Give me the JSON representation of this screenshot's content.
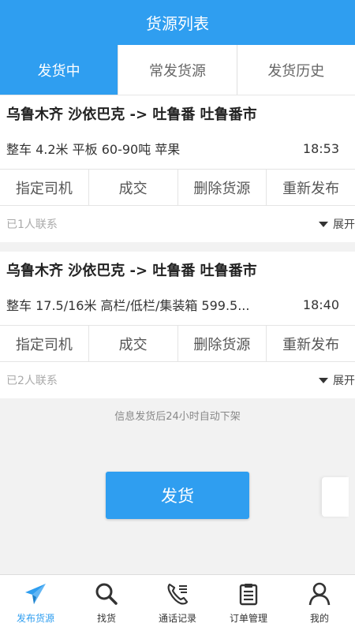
{
  "header": {
    "title": "货源列表"
  },
  "tabs": [
    {
      "label": "发货中",
      "active": true
    },
    {
      "label": "常发货源",
      "active": false
    },
    {
      "label": "发货历史",
      "active": false
    }
  ],
  "cargo": [
    {
      "route": "乌鲁木齐 沙依巴克 -> 吐鲁番 吐鲁番市",
      "info": "整车 4.2米 平板 60-90吨 苹果",
      "time": "18:53",
      "contacts": "已1人联系",
      "expand": "展开"
    },
    {
      "route": "乌鲁木齐 沙依巴克 -> 吐鲁番 吐鲁番市",
      "info": "整车 17.5/16米 高栏/低栏/集装箱 599.5...",
      "time": "18:40",
      "contacts": "已2人联系",
      "expand": "展开"
    }
  ],
  "actions": {
    "assign_driver": "指定司机",
    "deal": "成交",
    "delete": "删除货源",
    "republish": "重新发布"
  },
  "notice": "信息发货后24小时自动下架",
  "ship_button": "发货",
  "bottom_nav": [
    {
      "label": "发布货源",
      "icon": "paper-plane-icon",
      "active": true
    },
    {
      "label": "找货",
      "icon": "search-icon",
      "active": false
    },
    {
      "label": "通话记录",
      "icon": "phone-icon",
      "active": false
    },
    {
      "label": "订单管理",
      "icon": "clipboard-icon",
      "active": false
    },
    {
      "label": "我的",
      "icon": "user-icon",
      "active": false
    }
  ],
  "colors": {
    "primary": "#2f9ef0",
    "background": "#f2f2f2"
  }
}
